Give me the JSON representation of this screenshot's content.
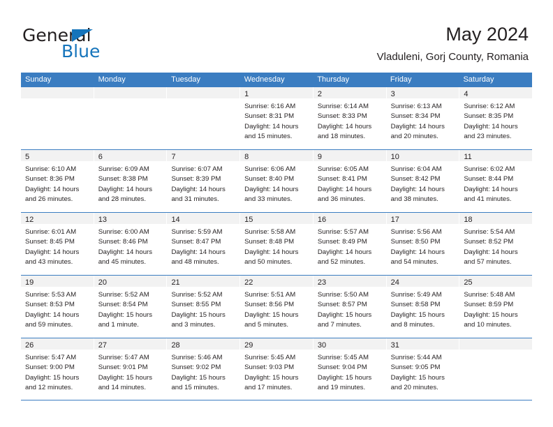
{
  "brand": {
    "name_part1": "General",
    "name_part2": "Blue",
    "triangle_color": "#1574bb"
  },
  "header": {
    "title": "May 2024",
    "subtitle": "Vladuleni, Gorj County, Romania"
  },
  "theme": {
    "header_row_bg": "#3b7dc1",
    "day_number_bg": "#f2f2f2",
    "text_color": "#231f20"
  },
  "weekdays": [
    "Sunday",
    "Monday",
    "Tuesday",
    "Wednesday",
    "Thursday",
    "Friday",
    "Saturday"
  ],
  "labels": {
    "sunrise_prefix": "Sunrise:",
    "sunset_prefix": "Sunset:",
    "daylight_prefix": "Daylight:"
  },
  "weeks": [
    [
      {
        "day": "",
        "empty": true
      },
      {
        "day": "",
        "empty": true
      },
      {
        "day": "",
        "empty": true
      },
      {
        "day": "1",
        "sunrise": "Sunrise: 6:16 AM",
        "sunset": "Sunset: 8:31 PM",
        "daylight_l1": "Daylight: 14 hours",
        "daylight_l2": "and 15 minutes."
      },
      {
        "day": "2",
        "sunrise": "Sunrise: 6:14 AM",
        "sunset": "Sunset: 8:33 PM",
        "daylight_l1": "Daylight: 14 hours",
        "daylight_l2": "and 18 minutes."
      },
      {
        "day": "3",
        "sunrise": "Sunrise: 6:13 AM",
        "sunset": "Sunset: 8:34 PM",
        "daylight_l1": "Daylight: 14 hours",
        "daylight_l2": "and 20 minutes."
      },
      {
        "day": "4",
        "sunrise": "Sunrise: 6:12 AM",
        "sunset": "Sunset: 8:35 PM",
        "daylight_l1": "Daylight: 14 hours",
        "daylight_l2": "and 23 minutes."
      }
    ],
    [
      {
        "day": "5",
        "sunrise": "Sunrise: 6:10 AM",
        "sunset": "Sunset: 8:36 PM",
        "daylight_l1": "Daylight: 14 hours",
        "daylight_l2": "and 26 minutes."
      },
      {
        "day": "6",
        "sunrise": "Sunrise: 6:09 AM",
        "sunset": "Sunset: 8:38 PM",
        "daylight_l1": "Daylight: 14 hours",
        "daylight_l2": "and 28 minutes."
      },
      {
        "day": "7",
        "sunrise": "Sunrise: 6:07 AM",
        "sunset": "Sunset: 8:39 PM",
        "daylight_l1": "Daylight: 14 hours",
        "daylight_l2": "and 31 minutes."
      },
      {
        "day": "8",
        "sunrise": "Sunrise: 6:06 AM",
        "sunset": "Sunset: 8:40 PM",
        "daylight_l1": "Daylight: 14 hours",
        "daylight_l2": "and 33 minutes."
      },
      {
        "day": "9",
        "sunrise": "Sunrise: 6:05 AM",
        "sunset": "Sunset: 8:41 PM",
        "daylight_l1": "Daylight: 14 hours",
        "daylight_l2": "and 36 minutes."
      },
      {
        "day": "10",
        "sunrise": "Sunrise: 6:04 AM",
        "sunset": "Sunset: 8:42 PM",
        "daylight_l1": "Daylight: 14 hours",
        "daylight_l2": "and 38 minutes."
      },
      {
        "day": "11",
        "sunrise": "Sunrise: 6:02 AM",
        "sunset": "Sunset: 8:44 PM",
        "daylight_l1": "Daylight: 14 hours",
        "daylight_l2": "and 41 minutes."
      }
    ],
    [
      {
        "day": "12",
        "sunrise": "Sunrise: 6:01 AM",
        "sunset": "Sunset: 8:45 PM",
        "daylight_l1": "Daylight: 14 hours",
        "daylight_l2": "and 43 minutes."
      },
      {
        "day": "13",
        "sunrise": "Sunrise: 6:00 AM",
        "sunset": "Sunset: 8:46 PM",
        "daylight_l1": "Daylight: 14 hours",
        "daylight_l2": "and 45 minutes."
      },
      {
        "day": "14",
        "sunrise": "Sunrise: 5:59 AM",
        "sunset": "Sunset: 8:47 PM",
        "daylight_l1": "Daylight: 14 hours",
        "daylight_l2": "and 48 minutes."
      },
      {
        "day": "15",
        "sunrise": "Sunrise: 5:58 AM",
        "sunset": "Sunset: 8:48 PM",
        "daylight_l1": "Daylight: 14 hours",
        "daylight_l2": "and 50 minutes."
      },
      {
        "day": "16",
        "sunrise": "Sunrise: 5:57 AM",
        "sunset": "Sunset: 8:49 PM",
        "daylight_l1": "Daylight: 14 hours",
        "daylight_l2": "and 52 minutes."
      },
      {
        "day": "17",
        "sunrise": "Sunrise: 5:56 AM",
        "sunset": "Sunset: 8:50 PM",
        "daylight_l1": "Daylight: 14 hours",
        "daylight_l2": "and 54 minutes."
      },
      {
        "day": "18",
        "sunrise": "Sunrise: 5:54 AM",
        "sunset": "Sunset: 8:52 PM",
        "daylight_l1": "Daylight: 14 hours",
        "daylight_l2": "and 57 minutes."
      }
    ],
    [
      {
        "day": "19",
        "sunrise": "Sunrise: 5:53 AM",
        "sunset": "Sunset: 8:53 PM",
        "daylight_l1": "Daylight: 14 hours",
        "daylight_l2": "and 59 minutes."
      },
      {
        "day": "20",
        "sunrise": "Sunrise: 5:52 AM",
        "sunset": "Sunset: 8:54 PM",
        "daylight_l1": "Daylight: 15 hours",
        "daylight_l2": "and 1 minute."
      },
      {
        "day": "21",
        "sunrise": "Sunrise: 5:52 AM",
        "sunset": "Sunset: 8:55 PM",
        "daylight_l1": "Daylight: 15 hours",
        "daylight_l2": "and 3 minutes."
      },
      {
        "day": "22",
        "sunrise": "Sunrise: 5:51 AM",
        "sunset": "Sunset: 8:56 PM",
        "daylight_l1": "Daylight: 15 hours",
        "daylight_l2": "and 5 minutes."
      },
      {
        "day": "23",
        "sunrise": "Sunrise: 5:50 AM",
        "sunset": "Sunset: 8:57 PM",
        "daylight_l1": "Daylight: 15 hours",
        "daylight_l2": "and 7 minutes."
      },
      {
        "day": "24",
        "sunrise": "Sunrise: 5:49 AM",
        "sunset": "Sunset: 8:58 PM",
        "daylight_l1": "Daylight: 15 hours",
        "daylight_l2": "and 8 minutes."
      },
      {
        "day": "25",
        "sunrise": "Sunrise: 5:48 AM",
        "sunset": "Sunset: 8:59 PM",
        "daylight_l1": "Daylight: 15 hours",
        "daylight_l2": "and 10 minutes."
      }
    ],
    [
      {
        "day": "26",
        "sunrise": "Sunrise: 5:47 AM",
        "sunset": "Sunset: 9:00 PM",
        "daylight_l1": "Daylight: 15 hours",
        "daylight_l2": "and 12 minutes."
      },
      {
        "day": "27",
        "sunrise": "Sunrise: 5:47 AM",
        "sunset": "Sunset: 9:01 PM",
        "daylight_l1": "Daylight: 15 hours",
        "daylight_l2": "and 14 minutes."
      },
      {
        "day": "28",
        "sunrise": "Sunrise: 5:46 AM",
        "sunset": "Sunset: 9:02 PM",
        "daylight_l1": "Daylight: 15 hours",
        "daylight_l2": "and 15 minutes."
      },
      {
        "day": "29",
        "sunrise": "Sunrise: 5:45 AM",
        "sunset": "Sunset: 9:03 PM",
        "daylight_l1": "Daylight: 15 hours",
        "daylight_l2": "and 17 minutes."
      },
      {
        "day": "30",
        "sunrise": "Sunrise: 5:45 AM",
        "sunset": "Sunset: 9:04 PM",
        "daylight_l1": "Daylight: 15 hours",
        "daylight_l2": "and 19 minutes."
      },
      {
        "day": "31",
        "sunrise": "Sunrise: 5:44 AM",
        "sunset": "Sunset: 9:05 PM",
        "daylight_l1": "Daylight: 15 hours",
        "daylight_l2": "and 20 minutes."
      },
      {
        "day": "",
        "empty": true
      }
    ]
  ]
}
